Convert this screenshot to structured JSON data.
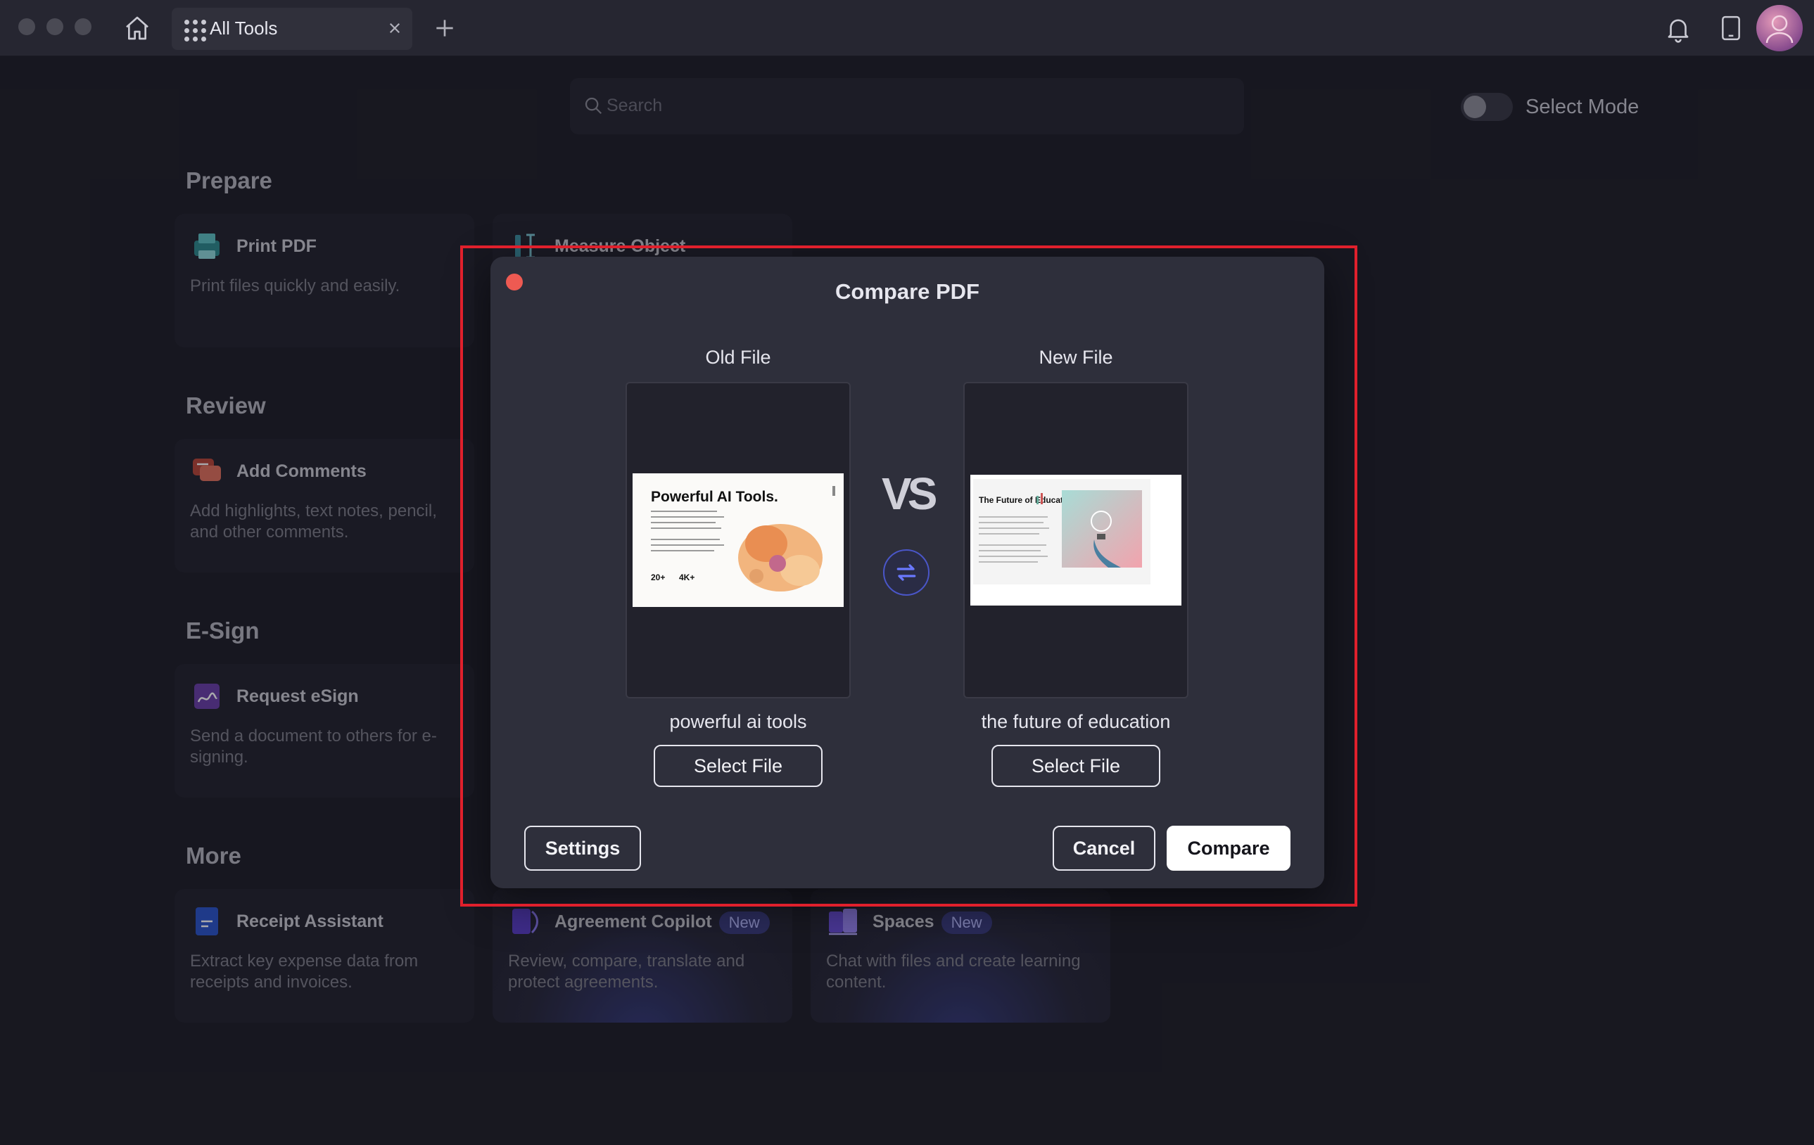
{
  "window": {
    "tab_label": "All Tools",
    "icons": {
      "home": "home-icon",
      "grid": "grid-icon",
      "close": "close-icon",
      "add": "plus-icon",
      "bell": "bell-icon",
      "device": "tablet-icon",
      "avatar": "avatar"
    }
  },
  "search": {
    "placeholder": "Search"
  },
  "select_mode": {
    "label": "Select Mode",
    "enabled": false
  },
  "sections": {
    "prepare": {
      "title": "Prepare",
      "cards": [
        {
          "title": "Print PDF",
          "desc": "Print files quickly and easily."
        },
        {
          "title": "Measure Object",
          "desc": ""
        }
      ]
    },
    "review": {
      "title": "Review",
      "cards": [
        {
          "title": "Add Comments",
          "desc": "Add highlights, text notes, pencil, and other comments."
        }
      ]
    },
    "esign": {
      "title": "E-Sign",
      "cards": [
        {
          "title": "Request eSign",
          "desc": "Send a document to others for e-signing."
        }
      ]
    },
    "more": {
      "title": "More",
      "cards": [
        {
          "title": "Receipt Assistant",
          "desc": "Extract key expense data from receipts and invoices."
        },
        {
          "title": "Agreement Copilot",
          "badge": "New",
          "desc": "Review, compare, translate and protect agreements."
        },
        {
          "title": "Spaces",
          "badge": "New",
          "desc": "Chat with files and create learning content."
        }
      ]
    }
  },
  "dialog": {
    "title": "Compare PDF",
    "old_file": {
      "label": "Old File",
      "name": "powerful ai tools",
      "select_label": "Select File",
      "thumb_title": "Powerful AI Tools.",
      "thumb_stats": [
        "20+",
        "4K+"
      ]
    },
    "vs_label": "VS",
    "new_file": {
      "label": "New File",
      "name": "the future of education",
      "select_label": "Select File",
      "thumb_title": "The Future of Education"
    },
    "settings_label": "Settings",
    "cancel_label": "Cancel",
    "compare_label": "Compare"
  },
  "colors": {
    "background": "#1f1f29",
    "dialog": "#2e2f3b",
    "highlight": "#e0202c",
    "badge": "#3b3c7e",
    "close_dot": "#ee5a52"
  }
}
